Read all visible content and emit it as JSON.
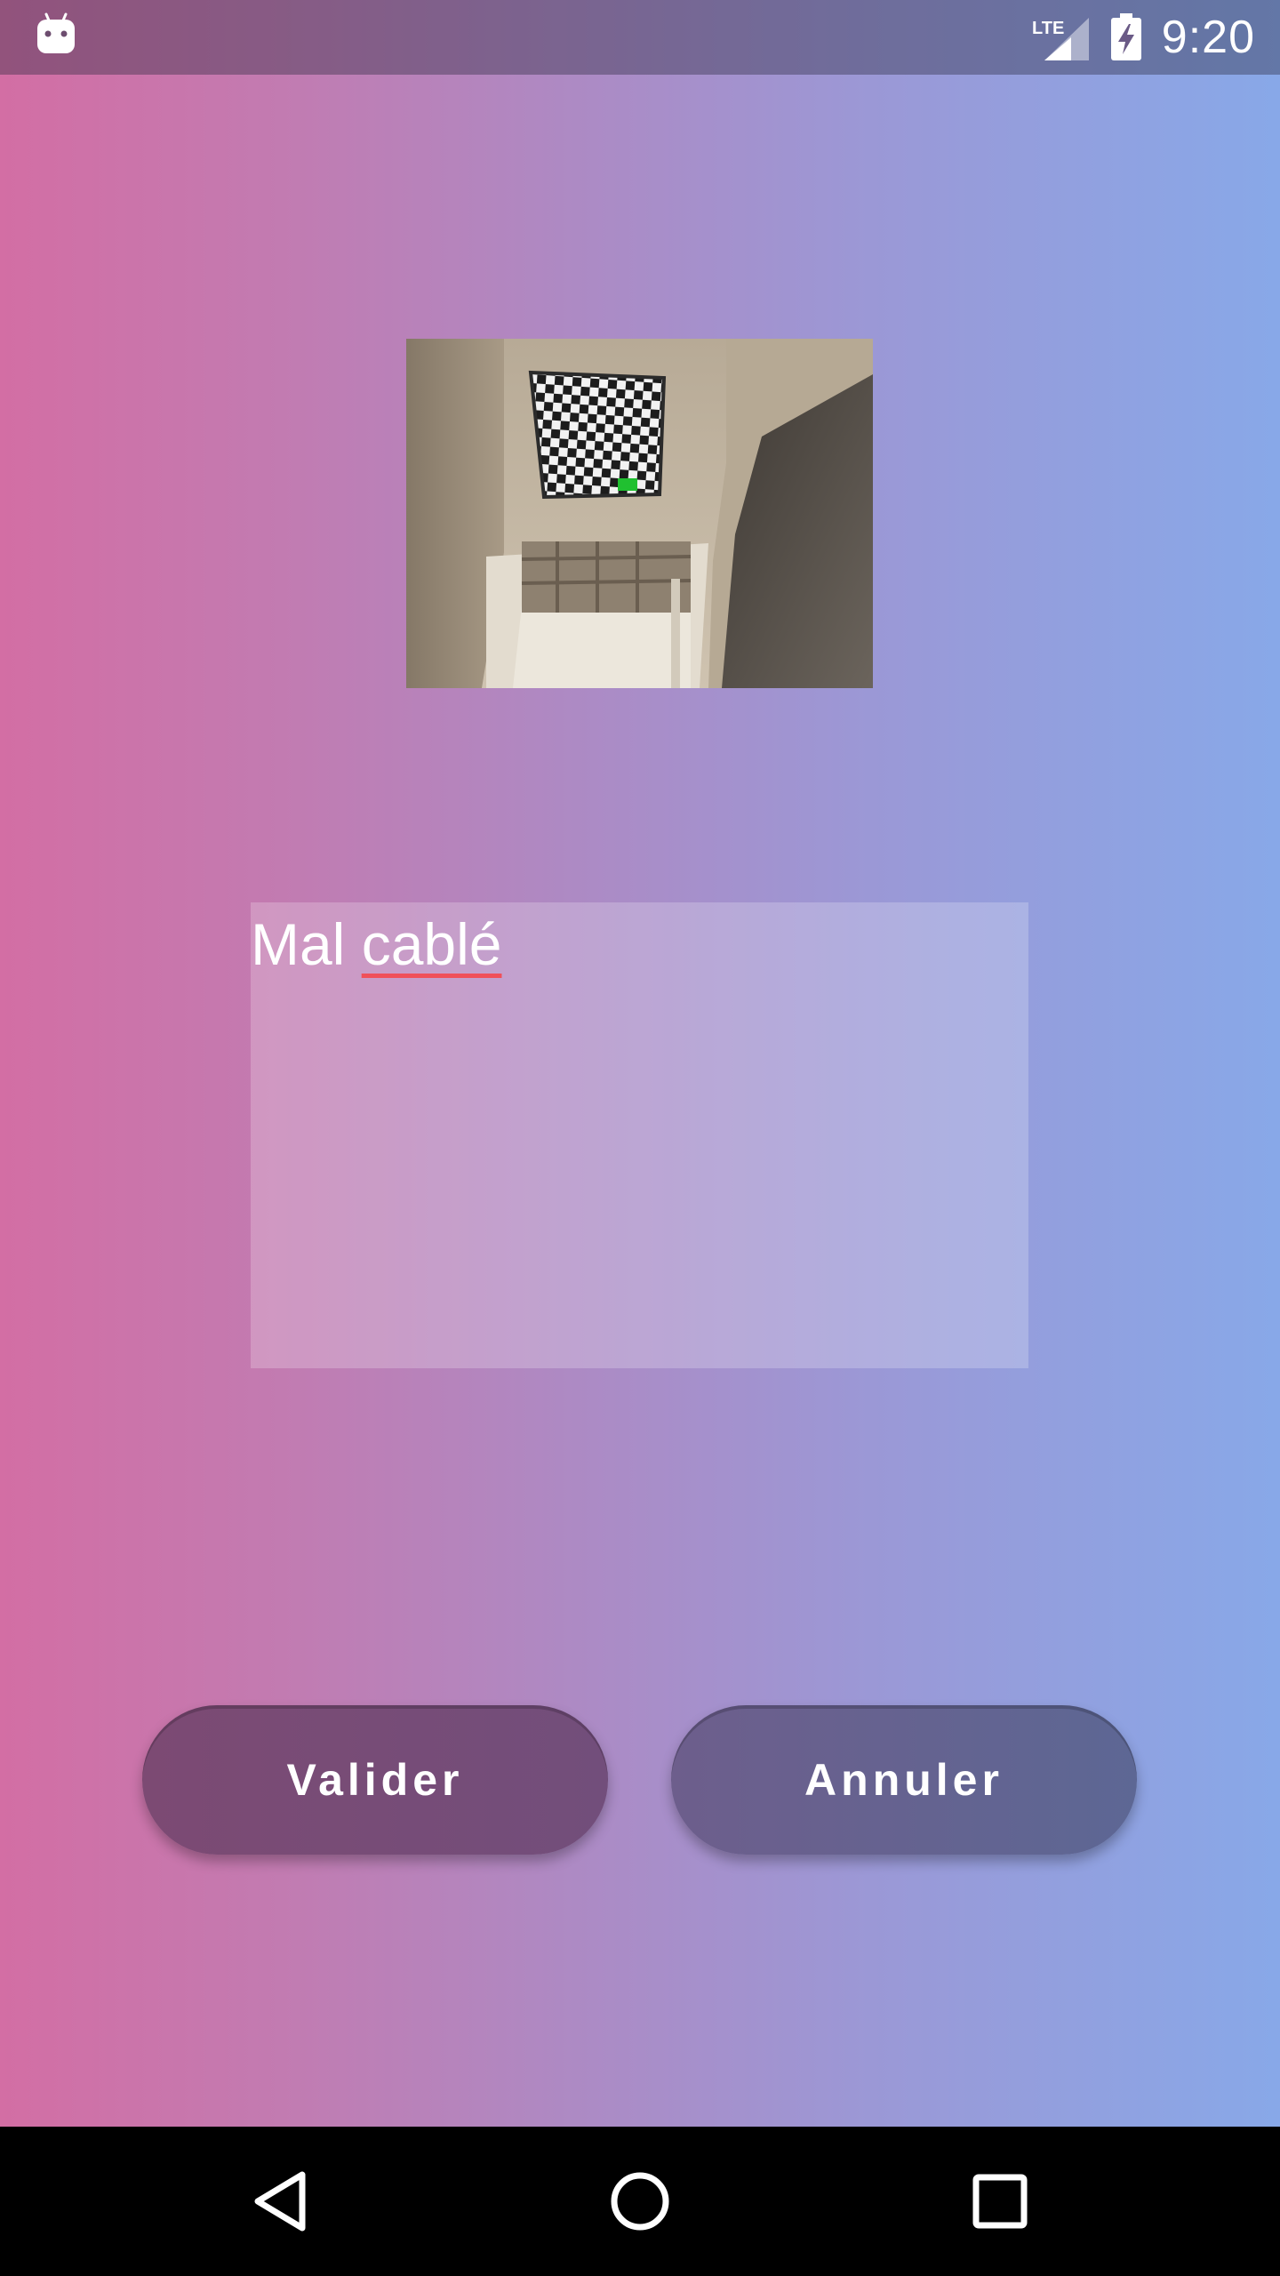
{
  "status_bar": {
    "notification_icon": "android-icon",
    "network": "LTE",
    "battery_icon": "battery-charging-icon",
    "time": "9:20"
  },
  "photo": {
    "subject_icon": "photo-thumbnail"
  },
  "note": {
    "word1": "Mal ",
    "word2": "cablé"
  },
  "buttons": {
    "validate_label": "Valider",
    "cancel_label": "Annuler"
  },
  "nav": {
    "back_icon": "back-triangle-icon",
    "home_icon": "home-circle-icon",
    "recents_icon": "recents-square-icon"
  },
  "colors": {
    "gradient_left": "#d36ea4",
    "gradient_right": "#88a8e8",
    "spellcheck_underline": "#f0505a",
    "validate_button": "#7c4a73",
    "cancel_button": "#5d6794"
  }
}
